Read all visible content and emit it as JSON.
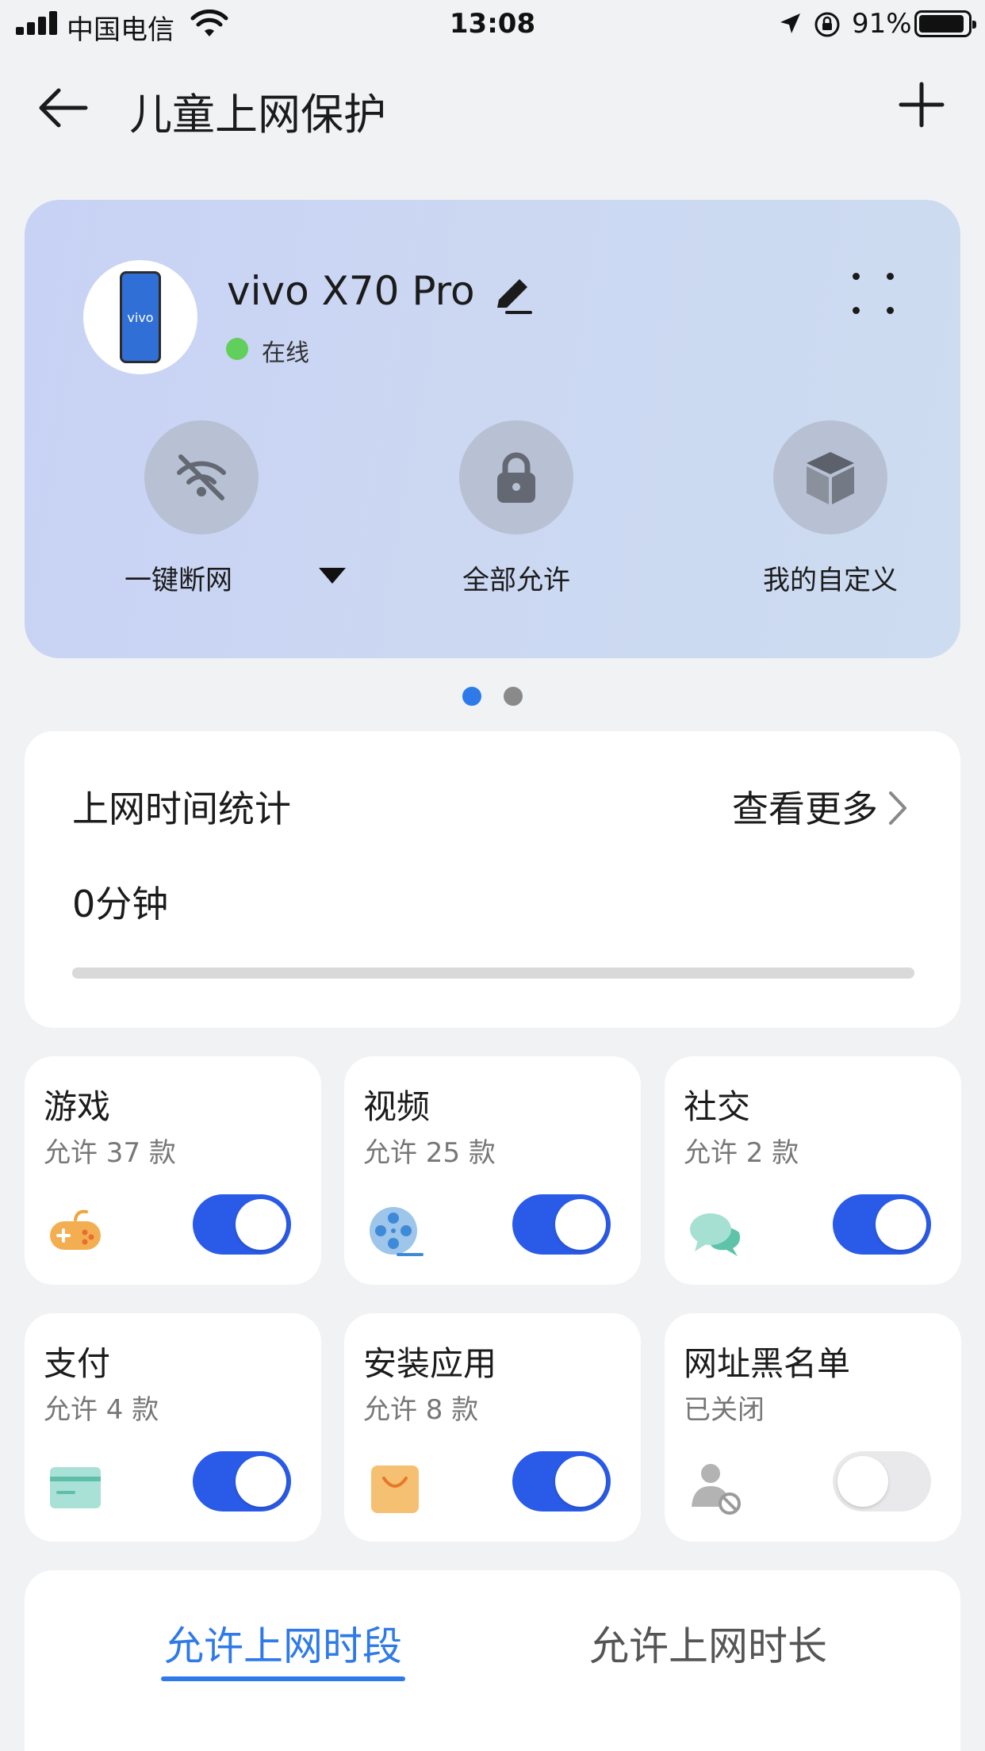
{
  "status_bar": {
    "carrier": "中国电信",
    "time": "13:08",
    "battery": "91%",
    "icons": [
      "signal-icon",
      "wifi-icon",
      "location-icon",
      "rotation-lock-icon",
      "battery-icon"
    ]
  },
  "header": {
    "title": "儿童上网保护",
    "back_icon": "arrow-left-icon",
    "add_icon": "plus-icon"
  },
  "device": {
    "name": "vivo X70 Pro",
    "phone_brand_text": "vivo",
    "status": "在线",
    "status_color": "#61cf5c",
    "actions": [
      {
        "label": "一键断网",
        "icon": "wifi-off-icon",
        "has_dropdown": true
      },
      {
        "label": "全部允许",
        "icon": "lock-icon"
      },
      {
        "label": "我的自定义",
        "icon": "cube-icon"
      }
    ],
    "pager": {
      "pages": 2,
      "active": 1
    }
  },
  "stats": {
    "title": "上网时间统计",
    "more_label": "查看更多",
    "value": "0分钟",
    "progress": 0
  },
  "categories": [
    {
      "title": "游戏",
      "subtitle": "允许 37 款",
      "icon": "gamepad-icon",
      "enabled": true
    },
    {
      "title": "视频",
      "subtitle": "允许 25 款",
      "icon": "film-reel-icon",
      "enabled": true
    },
    {
      "title": "社交",
      "subtitle": "允许 2 款",
      "icon": "chat-bubbles-icon",
      "enabled": true
    },
    {
      "title": "支付",
      "subtitle": "允许 4 款",
      "icon": "card-icon",
      "enabled": true
    },
    {
      "title": "安装应用",
      "subtitle": "允许 8 款",
      "icon": "shopping-bag-icon",
      "enabled": true
    },
    {
      "title": "网址黑名单",
      "subtitle": "已关闭",
      "icon": "user-blocked-icon",
      "enabled": false
    }
  ],
  "time_tabs": {
    "tabs": [
      "允许上网时段",
      "允许上网时长"
    ],
    "active": 0
  },
  "colors": {
    "accent": "#2f7ae9",
    "toggle_on": "#2a5be8",
    "background": "#f1f2f4"
  }
}
